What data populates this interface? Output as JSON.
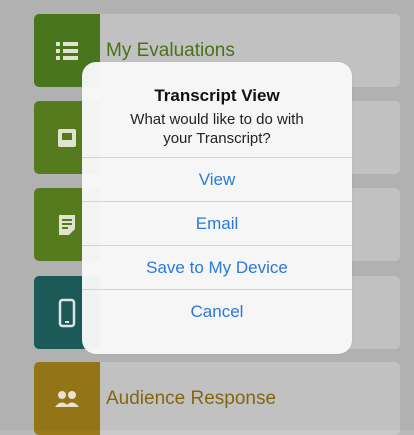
{
  "menu": {
    "items": [
      {
        "label": "My Evaluations",
        "icon": "list-icon",
        "icon_color": "#4d7a1f"
      },
      {
        "label": "",
        "icon": "book-icon",
        "icon_color": "#5a8120"
      },
      {
        "label": "",
        "icon": "document-icon",
        "icon_color": "#5a8120"
      },
      {
        "label": "",
        "icon": "phone-icon",
        "icon_color": "#1d5e5b"
      },
      {
        "label": "Audience Response",
        "icon": "people-icon",
        "icon_color": "#9a7a18"
      }
    ],
    "label_colors": {
      "green": "#4f7619",
      "gold": "#8a6a12"
    }
  },
  "dialog": {
    "title": "Transcript View",
    "message": "What would like to do with your Transcript?",
    "actions": [
      "View",
      "Email",
      "Save to My Device",
      "Cancel"
    ]
  }
}
